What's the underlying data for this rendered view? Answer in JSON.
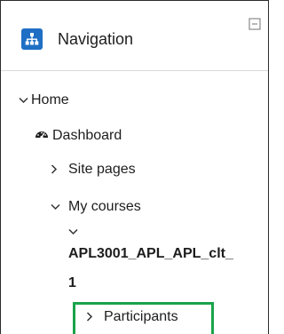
{
  "block": {
    "title": "Navigation",
    "icon": "sitemap-icon",
    "collapse_icon": "minus-square-icon",
    "accent": "#1f6fc5"
  },
  "nav": {
    "home": "Home",
    "dashboard": "Dashboard",
    "site_pages": "Site pages",
    "my_courses": "My courses",
    "course_line1": "APL3001_APL_APL_clt_",
    "course_line2": "1",
    "participants": "Participants"
  },
  "highlight_color": "#19a34a"
}
